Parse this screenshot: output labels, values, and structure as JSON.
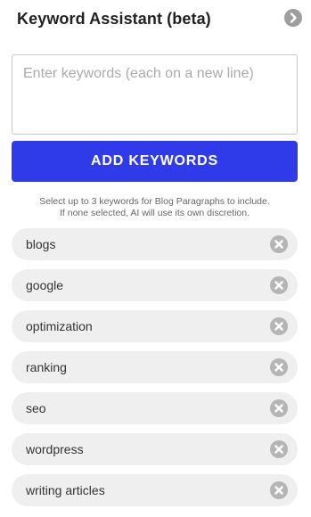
{
  "header": {
    "title": "Keyword Assistant (beta)",
    "collapse_icon": "chevron-right-circle-icon"
  },
  "input": {
    "value": "",
    "placeholder": "Enter keywords (each on a new line)"
  },
  "add_button": {
    "label": "ADD KEYWORDS",
    "color": "#2f3be8"
  },
  "hint": {
    "line1": "Select up to 3 keywords for Blog Paragraphs to include.",
    "line2": "If none selected, AI will use its own discretion."
  },
  "keywords": [
    {
      "label": "blogs",
      "remove_icon": "remove-x-circle-icon"
    },
    {
      "label": "google",
      "remove_icon": "remove-x-circle-icon"
    },
    {
      "label": "optimization",
      "remove_icon": "remove-x-circle-icon"
    },
    {
      "label": "ranking",
      "remove_icon": "remove-x-circle-icon"
    },
    {
      "label": "seo",
      "remove_icon": "remove-x-circle-icon"
    },
    {
      "label": "wordpress",
      "remove_icon": "remove-x-circle-icon"
    },
    {
      "label": "writing articles",
      "remove_icon": "remove-x-circle-icon"
    }
  ]
}
